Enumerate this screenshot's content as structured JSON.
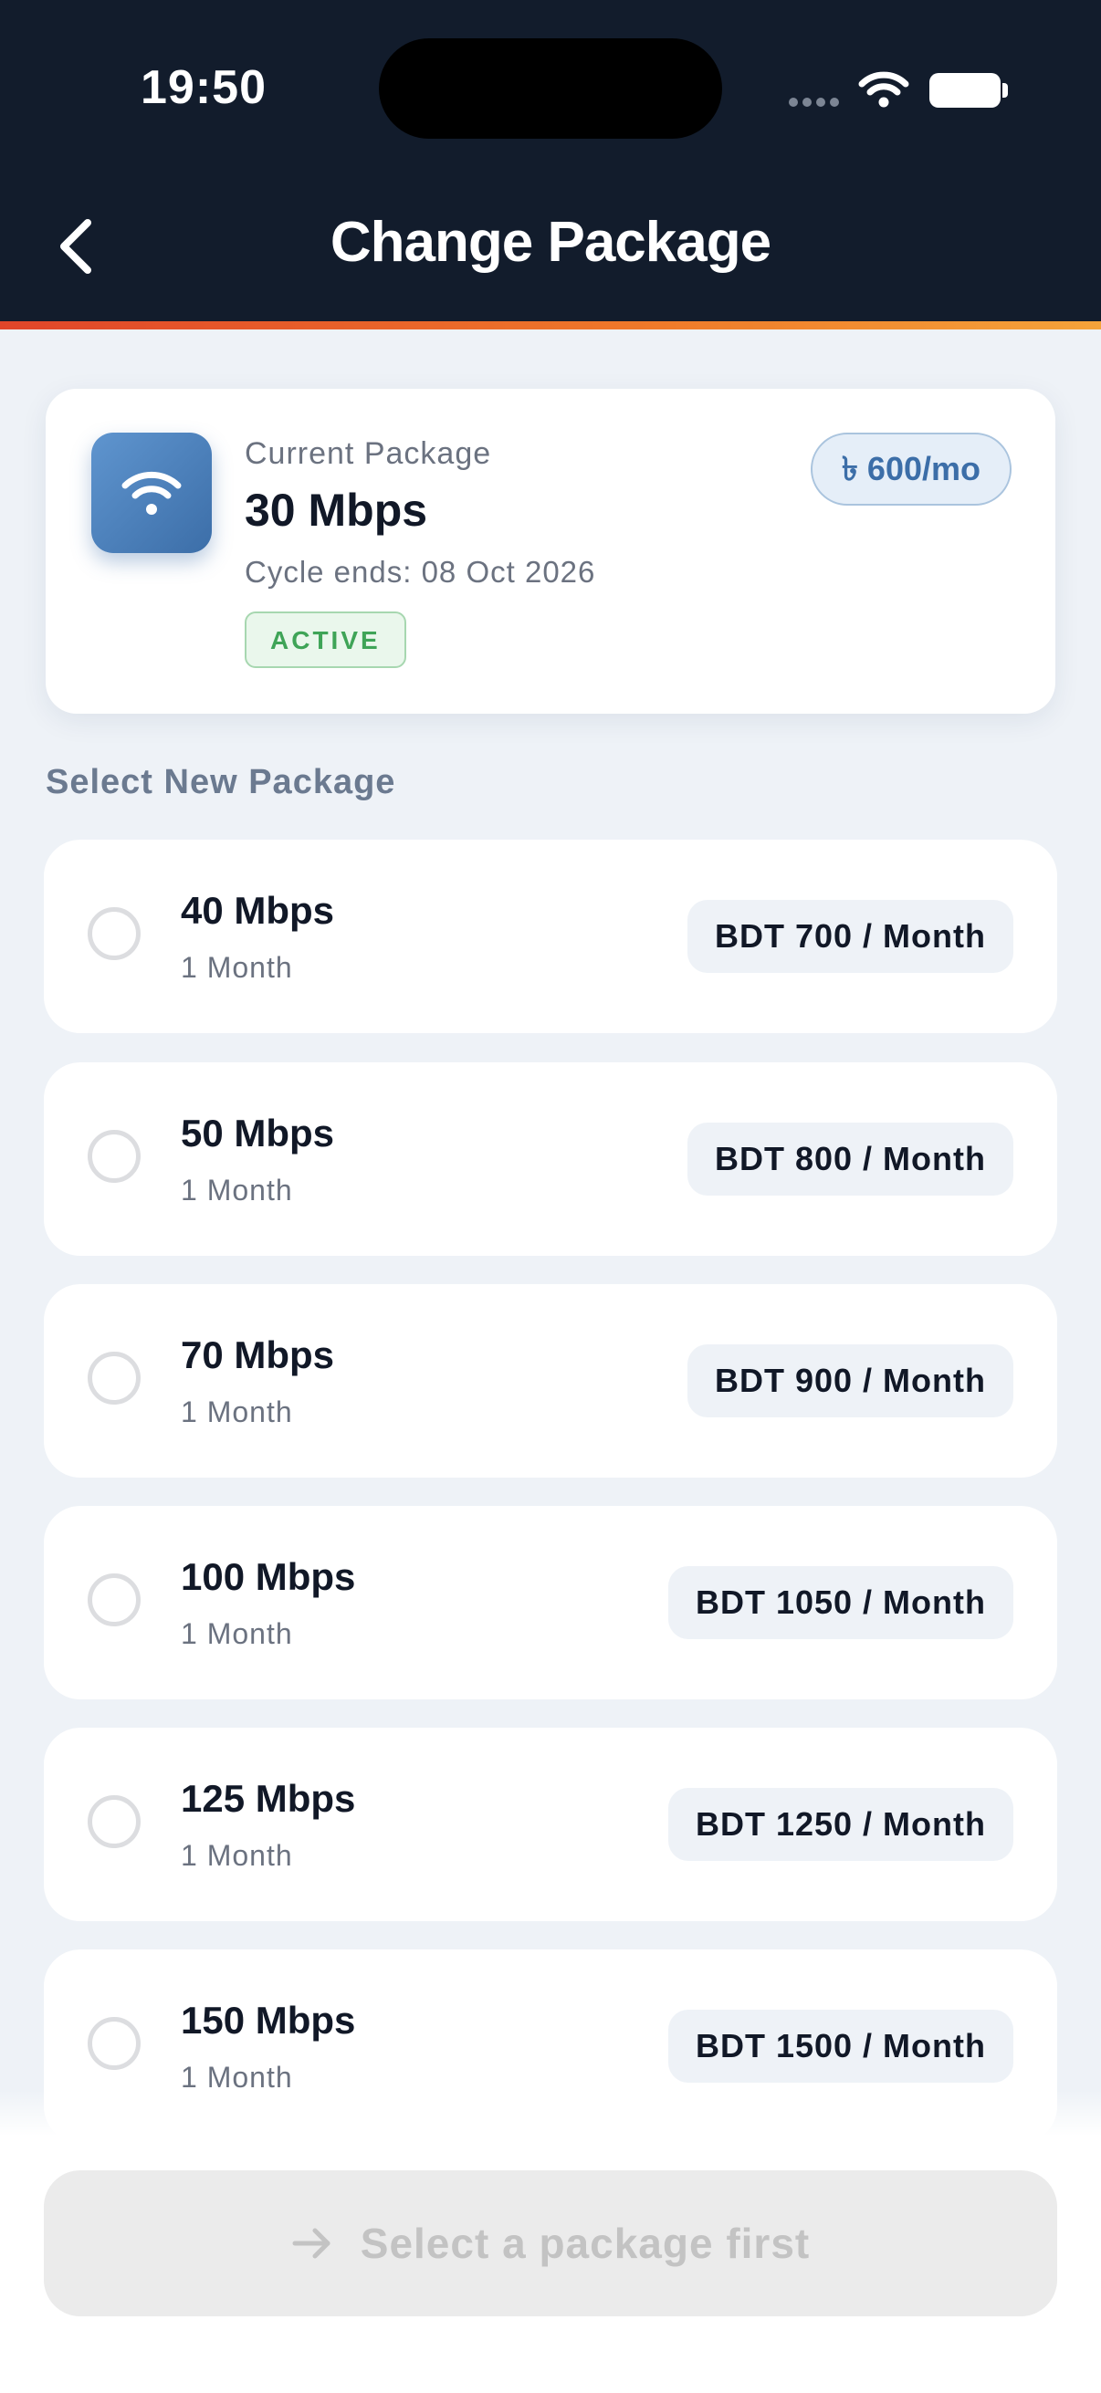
{
  "status_bar": {
    "time": "19:50"
  },
  "header": {
    "title": "Change Package"
  },
  "current_package": {
    "label": "Current Package",
    "speed": "30 Mbps",
    "cycle": "Cycle ends: 08 Oct 2026",
    "status": "ACTIVE",
    "price": "৳ 600/mo"
  },
  "section_title": "Select New Package",
  "packages": [
    {
      "speed": "40 Mbps",
      "duration": "1 Month",
      "price": "BDT 700 / Month"
    },
    {
      "speed": "50 Mbps",
      "duration": "1 Month",
      "price": "BDT 800 / Month"
    },
    {
      "speed": "70 Mbps",
      "duration": "1 Month",
      "price": "BDT 900 / Month"
    },
    {
      "speed": "100 Mbps",
      "duration": "1 Month",
      "price": "BDT 1050 / Month"
    },
    {
      "speed": "125 Mbps",
      "duration": "1 Month",
      "price": "BDT 1250 / Month"
    },
    {
      "speed": "150 Mbps",
      "duration": "1 Month",
      "price": "BDT 1500 / Month"
    }
  ],
  "cta": {
    "label": "Select a package first"
  },
  "colors": {
    "header_bg": "#121c2c",
    "accent": "#e0452a",
    "active_green": "#3fa457",
    "brand_blue": "#3c6ea8"
  },
  "icons": {
    "back": "chevron-left-icon",
    "wifi": "wifi-icon",
    "cta": "arrow-right-icon"
  }
}
